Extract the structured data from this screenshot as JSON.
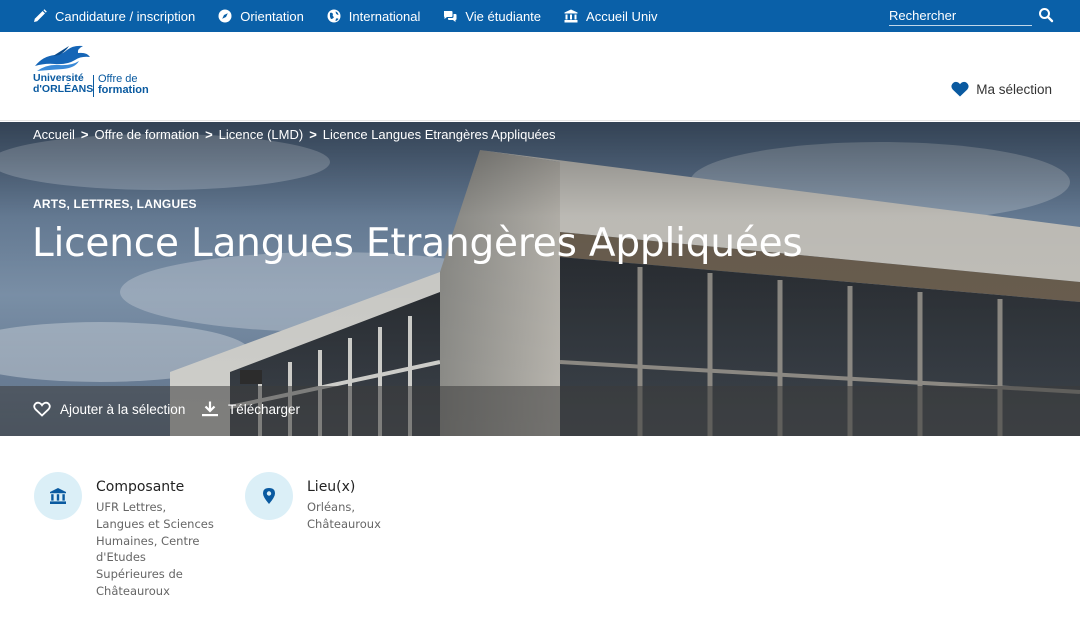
{
  "topbar": {
    "items": [
      {
        "label": "Candidature / inscription",
        "icon": "pencil-icon"
      },
      {
        "label": "Orientation",
        "icon": "compass-icon"
      },
      {
        "label": "International",
        "icon": "globe-icon"
      },
      {
        "label": "Vie étudiante",
        "icon": "chat-icon"
      },
      {
        "label": "Accueil Univ",
        "icon": "university-icon"
      }
    ],
    "search_placeholder": "Rechercher",
    "bg_color": "#0a60a8"
  },
  "header": {
    "logo_line1": "Université",
    "logo_line2": "d'ORLÉANS",
    "logo_offre_line1": "Offre de",
    "logo_offre_line2": "formation",
    "ma_selection": "Ma sélection",
    "accent_color": "#0a5aa0"
  },
  "hero": {
    "breadcrumb": [
      "Accueil",
      "Offre de formation",
      "Licence (LMD)",
      "Licence Langues Etrangères Appliquées"
    ],
    "category": "ARTS, LETTRES, LANGUES",
    "title": "Licence Langues Etrangères Appliquées",
    "actions": {
      "add_selection": "Ajouter à la sélection",
      "download": "Télécharger"
    }
  },
  "info": {
    "composante": {
      "title": "Composante",
      "value": "UFR Lettres, Langues et Sciences Humaines, Centre d'Etudes Supérieures de Châteauroux",
      "icon": "university-icon"
    },
    "lieux": {
      "title": "Lieu(x)",
      "value": "Orléans, Châteauroux",
      "icon": "map-pin-icon"
    }
  }
}
